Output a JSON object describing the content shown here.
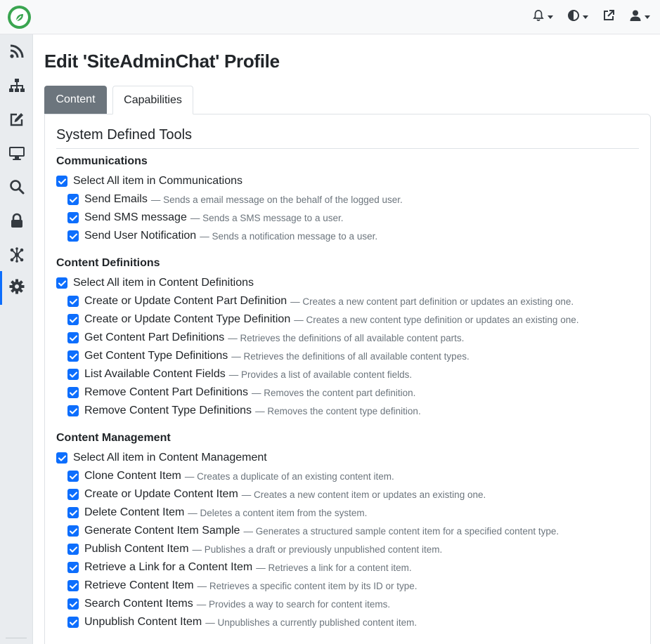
{
  "page_title": "Edit 'SiteAdminChat' Profile",
  "tabs": [
    {
      "label": "Content",
      "active": false
    },
    {
      "label": "Capabilities",
      "active": true
    }
  ],
  "section_title": "System Defined Tools",
  "groups": [
    {
      "title": "Communications",
      "select_all": "Select All item in Communications",
      "tools": [
        {
          "name": "Send Emails",
          "desc": "— Sends a email message on the behalf of the logged user."
        },
        {
          "name": "Send SMS message",
          "desc": "— Sends a SMS message to a user."
        },
        {
          "name": "Send User Notification",
          "desc": "— Sends a notification message to a user."
        }
      ]
    },
    {
      "title": "Content Definitions",
      "select_all": "Select All item in Content Definitions",
      "tools": [
        {
          "name": "Create or Update Content Part Definition",
          "desc": "— Creates a new content part definition or updates an existing one."
        },
        {
          "name": "Create or Update Content Type Definition",
          "desc": "— Creates a new content type definition or updates an existing one."
        },
        {
          "name": "Get Content Part Definitions",
          "desc": "— Retrieves the definitions of all available content parts."
        },
        {
          "name": "Get Content Type Definitions",
          "desc": "— Retrieves the definitions of all available content types."
        },
        {
          "name": "List Available Content Fields",
          "desc": "— Provides a list of available content fields."
        },
        {
          "name": "Remove Content Part Definitions",
          "desc": "— Removes the content part definition."
        },
        {
          "name": "Remove Content Type Definitions",
          "desc": "— Removes the content type definition."
        }
      ]
    },
    {
      "title": "Content Management",
      "select_all": "Select All item in Content Management",
      "tools": [
        {
          "name": "Clone Content Item",
          "desc": "— Creates a duplicate of an existing content item."
        },
        {
          "name": "Create or Update Content Item",
          "desc": "— Creates a new content item or updates an existing one."
        },
        {
          "name": "Delete Content Item",
          "desc": "— Deletes a content item from the system."
        },
        {
          "name": "Generate Content Item Sample",
          "desc": "— Generates a structured sample content item for a specified content type."
        },
        {
          "name": "Publish Content Item",
          "desc": "— Publishes a draft or previously unpublished content item."
        },
        {
          "name": "Retrieve a Link for a Content Item",
          "desc": "— Retrieves a link for a content item."
        },
        {
          "name": "Retrieve Content Item",
          "desc": "— Retrieves a specific content item by its ID or type."
        },
        {
          "name": "Search Content Items",
          "desc": "— Provides a way to search for content items."
        },
        {
          "name": "Unpublish Content Item",
          "desc": "— Unpublishes a currently published content item."
        }
      ]
    }
  ],
  "sidebar_icons": [
    "rss-icon",
    "sitemap-icon",
    "edit-icon",
    "desktop-icon",
    "search-icon",
    "lock-icon",
    "network-icon",
    "gear-icon"
  ],
  "topbar_icons": [
    "bell-icon",
    "contrast-icon",
    "external-link-icon",
    "user-icon"
  ],
  "colors": {
    "accent": "#0d6efd",
    "logo": "#3aa550",
    "tab_active_bg": "#6c757d",
    "muted_text": "#6c757d"
  }
}
